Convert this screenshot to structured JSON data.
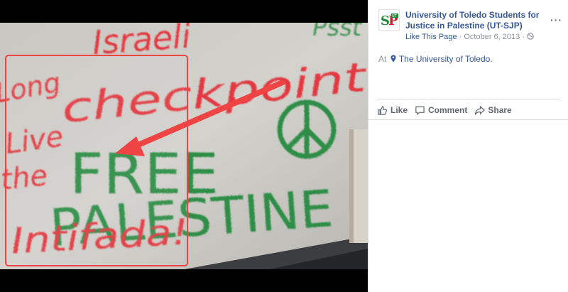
{
  "post": {
    "page_name": "University of Toledo Students for Justice in Palestine (UT-SJP)",
    "logo_text": {
      "s": "S",
      "p": "P",
      "ut": "UT"
    },
    "like_page": "Like This Page",
    "date": "October 6, 2013",
    "separator": "·",
    "audience_icon": "globe-icon",
    "more_icon": "more-options-icon",
    "location_prefix": "At",
    "location_icon": "map-pin-icon",
    "location_name": "The University of Toledo."
  },
  "actions": {
    "like": "Like",
    "comment": "Comment",
    "share": "Share"
  },
  "photo": {
    "red_graffiti": [
      "Israeli",
      "checkpoint",
      "Long",
      "Live",
      "the",
      "Intifada!"
    ],
    "green_graffiti": [
      "FREE",
      "PALESTINE",
      "Psst"
    ],
    "peace_symbol_icon": "peace-symbol-icon",
    "annotation": "red-arrow-and-box"
  },
  "colors": {
    "link_blue": "#365899",
    "meta_gray": "#90949c",
    "graffiti_red": "#e2373f",
    "graffiti_green": "#2f8e47",
    "annotation_red": "#ef4444"
  }
}
